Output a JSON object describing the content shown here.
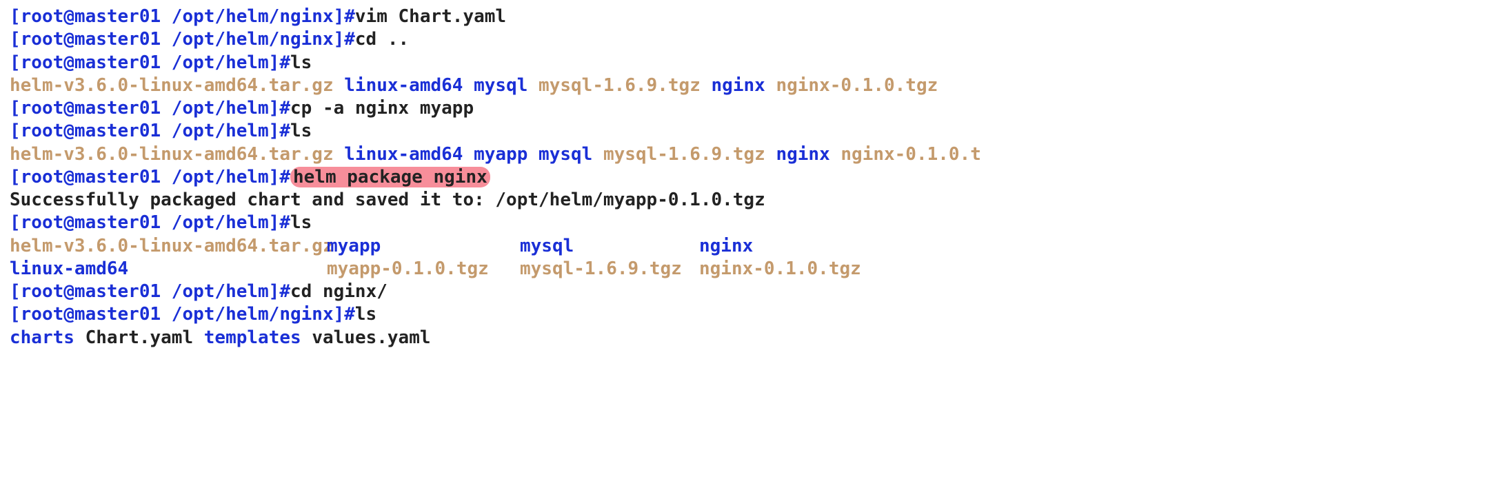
{
  "prompts": {
    "nginx": "[root@master01 /opt/helm/nginx]#",
    "helm": "[root@master01 /opt/helm]#"
  },
  "cmds": {
    "vim_chart": "vim Chart.yaml",
    "cd_up": "cd ..",
    "ls": "ls",
    "cp_nginx": "cp -a nginx myapp",
    "helm_pkg": "helm package nginx",
    "cd_nginx": "cd nginx/"
  },
  "ls1": {
    "tarball": "helm-v3.6.0-linux-amd64.tar.gz",
    "linux_amd64": "linux-amd64",
    "mysql": "mysql",
    "mysql_tgz": "mysql-1.6.9.tgz",
    "nginx": "nginx",
    "nginx_tgz": "nginx-0.1.0.tgz"
  },
  "ls2": {
    "tarball": "helm-v3.6.0-linux-amd64.tar.gz",
    "linux_amd64": "linux-amd64",
    "myapp": "myapp",
    "mysql": "mysql",
    "mysql_tgz": "mysql-1.6.9.tgz",
    "nginx": "nginx",
    "nginx_tgz": "nginx-0.1.0.t"
  },
  "pkg_output": "Successfully packaged chart and saved it to: /opt/helm/myapp-0.1.0.tgz",
  "ls3": {
    "r1c1": "helm-v3.6.0-linux-amd64.tar.gz",
    "r1c2": "myapp",
    "r1c3": "mysql",
    "r1c4": "nginx",
    "r2c1": "linux-amd64",
    "r2c2": "myapp-0.1.0.tgz",
    "r2c3": "mysql-1.6.9.tgz",
    "r2c4": "nginx-0.1.0.tgz"
  },
  "ls_nginx": {
    "charts": "charts",
    "chart_yaml": "Chart.yaml",
    "templates": "templates",
    "values": "values.yaml"
  },
  "sp3": "   ",
  "sp2": "  "
}
